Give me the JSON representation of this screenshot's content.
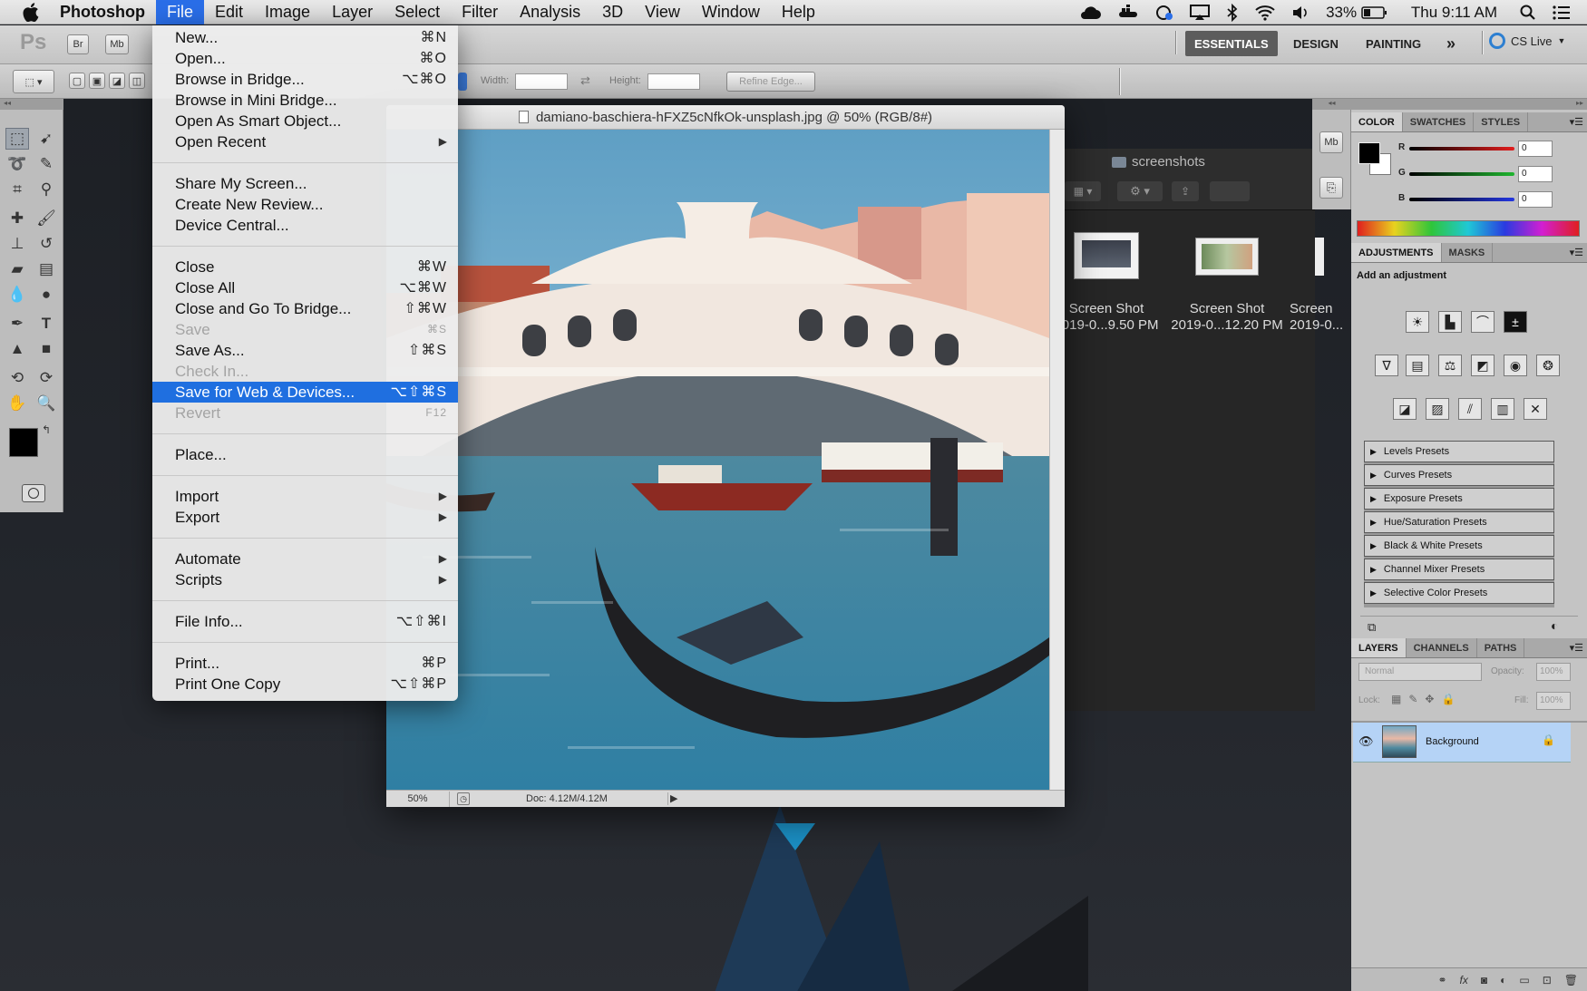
{
  "menubar": {
    "apple": "",
    "app_name": "Photoshop",
    "items": [
      "File",
      "Edit",
      "Image",
      "Layer",
      "Select",
      "Filter",
      "Analysis",
      "3D",
      "View",
      "Window",
      "Help"
    ],
    "active_item": "File",
    "status": {
      "battery": "33%",
      "clock": "Thu 9:11 AM"
    }
  },
  "appbar": {
    "logo": "Ps",
    "br": "Br",
    "mb": "Mb",
    "workspaces": [
      "ESSENTIALS",
      "DESIGN",
      "PAINTING"
    ],
    "more": "»",
    "cs_live": "CS Live"
  },
  "options": {
    "width_label": "Width:",
    "height_label": "Height:",
    "refine_edge": "Refine Edge..."
  },
  "document": {
    "title": "damiano-baschiera-hFXZ5cNfkOk-unsplash.jpg @ 50% (RGB/8#)",
    "zoom": "50%",
    "doc_size": "Doc: 4.12M/4.12M"
  },
  "finder": {
    "folder": "screenshots",
    "files": [
      {
        "name": "Screen Shot",
        "date": "2019-0...9.50 PM"
      },
      {
        "name": "Screen Shot",
        "date": "2019-0...12.20 PM"
      },
      {
        "name": "Screen",
        "date": "2019-0..."
      }
    ]
  },
  "file_menu": {
    "groups": [
      [
        {
          "label": "New...",
          "shortcut": "⌘N"
        },
        {
          "label": "Open...",
          "shortcut": "⌘O"
        },
        {
          "label": "Browse in Bridge...",
          "shortcut": "⌥⌘O"
        },
        {
          "label": "Browse in Mini Bridge...",
          "shortcut": ""
        },
        {
          "label": "Open As Smart Object...",
          "shortcut": ""
        },
        {
          "label": "Open Recent",
          "shortcut": "",
          "submenu": true
        }
      ],
      [
        {
          "label": "Share My Screen...",
          "shortcut": ""
        },
        {
          "label": "Create New Review...",
          "shortcut": ""
        },
        {
          "label": "Device Central...",
          "shortcut": ""
        }
      ],
      [
        {
          "label": "Close",
          "shortcut": "⌘W"
        },
        {
          "label": "Close All",
          "shortcut": "⌥⌘W"
        },
        {
          "label": "Close and Go To Bridge...",
          "shortcut": "⇧⌘W"
        },
        {
          "label": "Save",
          "shortcut": "⌘S",
          "disabled": true
        },
        {
          "label": "Save As...",
          "shortcut": "⇧⌘S"
        },
        {
          "label": "Check In...",
          "shortcut": "",
          "disabled": true
        },
        {
          "label": "Save for Web & Devices...",
          "shortcut": "⌥⇧⌘S",
          "highlighted": true
        },
        {
          "label": "Revert",
          "shortcut": "F12",
          "disabled": true
        }
      ],
      [
        {
          "label": "Place...",
          "shortcut": ""
        }
      ],
      [
        {
          "label": "Import",
          "shortcut": "",
          "submenu": true
        },
        {
          "label": "Export",
          "shortcut": "",
          "submenu": true
        }
      ],
      [
        {
          "label": "Automate",
          "shortcut": "",
          "submenu": true
        },
        {
          "label": "Scripts",
          "shortcut": "",
          "submenu": true
        }
      ],
      [
        {
          "label": "File Info...",
          "shortcut": "⌥⇧⌘I"
        }
      ],
      [
        {
          "label": "Print...",
          "shortcut": "⌘P"
        },
        {
          "label": "Print One Copy",
          "shortcut": "⌥⇧⌘P"
        }
      ]
    ]
  },
  "color_panel": {
    "tabs": [
      "COLOR",
      "SWATCHES",
      "STYLES"
    ],
    "channels": [
      {
        "label": "R",
        "value": "0",
        "color": "#d21f1f"
      },
      {
        "label": "G",
        "value": "0",
        "color": "#1fa12f"
      },
      {
        "label": "B",
        "value": "0",
        "color": "#2034d6"
      }
    ]
  },
  "adjustments_panel": {
    "tabs": [
      "ADJUSTMENTS",
      "MASKS"
    ],
    "heading": "Add an adjustment",
    "presets": [
      "Levels Presets",
      "Curves Presets",
      "Exposure Presets",
      "Hue/Saturation Presets",
      "Black & White Presets",
      "Channel Mixer Presets",
      "Selective Color Presets"
    ]
  },
  "layers_panel": {
    "tabs": [
      "LAYERS",
      "CHANNELS",
      "PATHS"
    ],
    "blend_mode": "Normal",
    "opacity_label": "Opacity:",
    "opacity": "100%",
    "lock_label": "Lock:",
    "fill_label": "Fill:",
    "fill": "100%",
    "layer_name": "Background"
  },
  "colors": {
    "menu_highlight": "#1f6fe0",
    "layer_selected": "#b5d3f6"
  }
}
